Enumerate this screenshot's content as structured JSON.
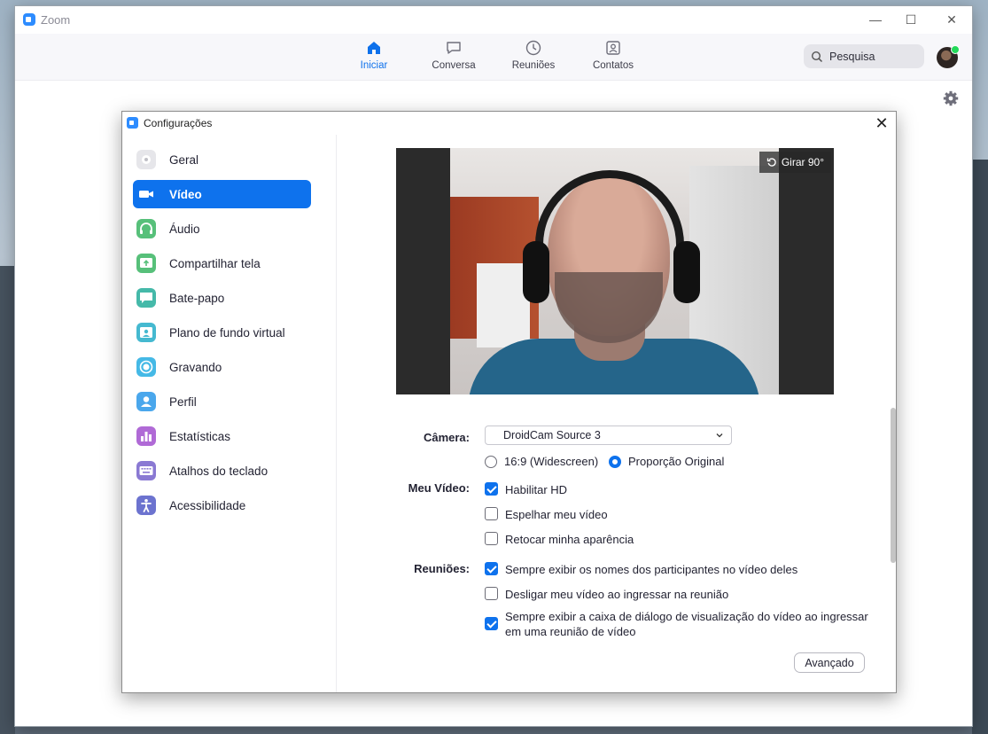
{
  "window": {
    "app_title": "Zoom",
    "minimize": "—",
    "maximize": "☐",
    "close": "✕"
  },
  "topnav": {
    "items": [
      {
        "label": "Iniciar",
        "icon": "home-icon",
        "active": true
      },
      {
        "label": "Conversa",
        "icon": "chat-icon",
        "active": false
      },
      {
        "label": "Reuniões",
        "icon": "clock-icon",
        "active": false
      },
      {
        "label": "Contatos",
        "icon": "contacts-icon",
        "active": false
      }
    ],
    "search_placeholder": "Pesquisa"
  },
  "settings": {
    "title": "Configurações",
    "close": "✕",
    "sidebar": [
      {
        "label": "Geral",
        "icon": "gear-icon",
        "color": "#d9d9de",
        "active": false
      },
      {
        "label": "Vídeo",
        "icon": "video-icon",
        "color": "#0e72ed",
        "active": true
      },
      {
        "label": "Áudio",
        "icon": "headphones-icon",
        "color": "#57c07a",
        "active": false
      },
      {
        "label": "Compartilhar tela",
        "icon": "share-screen-icon",
        "color": "#57c07a",
        "active": false
      },
      {
        "label": "Bate-papo",
        "icon": "chat-bubble-icon",
        "color": "#45b9a9",
        "active": false
      },
      {
        "label": "Plano de fundo virtual",
        "icon": "background-icon",
        "color": "#45b9d0",
        "active": false
      },
      {
        "label": "Gravando",
        "icon": "record-icon",
        "color": "#45b9e6",
        "active": false
      },
      {
        "label": "Perfil",
        "icon": "profile-icon",
        "color": "#4aa7ec",
        "active": false
      },
      {
        "label": "Estatísticas",
        "icon": "stats-icon",
        "color": "#b06ad6",
        "active": false
      },
      {
        "label": "Atalhos do teclado",
        "icon": "keyboard-icon",
        "color": "#8a79d3",
        "active": false
      },
      {
        "label": "Acessibilidade",
        "icon": "accessibility-icon",
        "color": "#6c73cf",
        "active": false
      }
    ],
    "video": {
      "rotate_label": "Girar 90°",
      "camera_label": "Câmera:",
      "camera_value": "DroidCam Source 3",
      "ratio_options": [
        {
          "label": "16:9 (Widescreen)",
          "selected": false
        },
        {
          "label": "Proporção Original",
          "selected": true
        }
      ],
      "my_video_label": "Meu Vídeo:",
      "my_video_options": [
        {
          "label": "Habilitar HD",
          "checked": true
        },
        {
          "label": "Espelhar meu vídeo",
          "checked": false
        },
        {
          "label": "Retocar minha aparência",
          "checked": false
        }
      ],
      "meetings_label": "Reuniões:",
      "meetings_options": [
        {
          "label": "Sempre exibir os nomes dos participantes no vídeo deles",
          "checked": true
        },
        {
          "label": "Desligar meu vídeo ao ingressar na reunião",
          "checked": false
        },
        {
          "label": "Sempre exibir a caixa de diálogo de visualização do vídeo ao ingressar em uma reunião de vídeo",
          "checked": true
        }
      ],
      "advanced_label": "Avançado"
    }
  }
}
